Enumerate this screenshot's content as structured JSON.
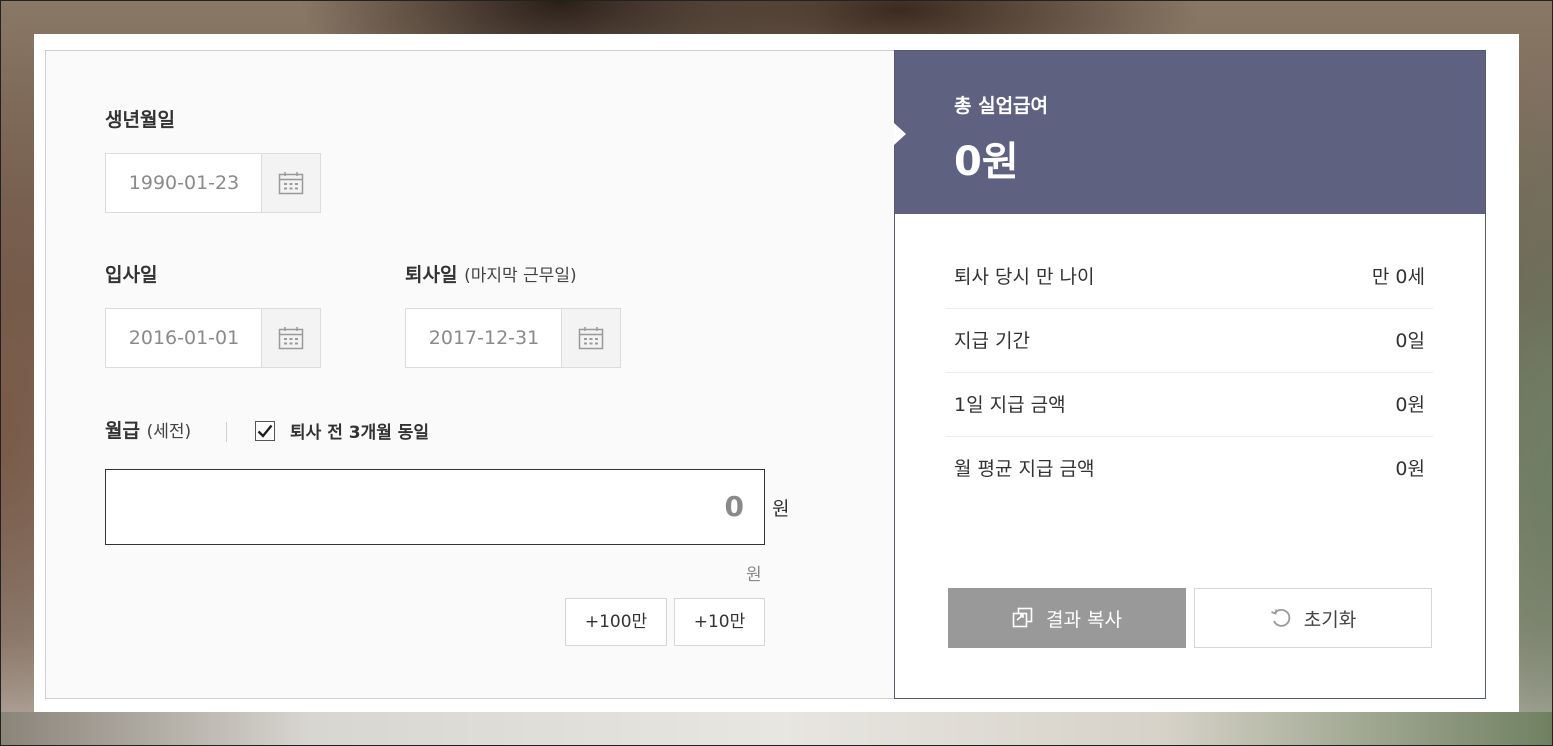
{
  "form": {
    "birth": {
      "label": "생년월일",
      "value": "1990-01-23"
    },
    "join": {
      "label": "입사일",
      "value": "2016-01-01"
    },
    "leave": {
      "label": "퇴사일",
      "label_sub": "(마지막 근무일)",
      "value": "2017-12-31"
    },
    "salary": {
      "label": "월급",
      "label_sub": "(세전)",
      "checkbox_label": "퇴사 전 3개월 동일",
      "checkbox_checked": true,
      "value": "0",
      "unit": "원",
      "unit_hint": "원",
      "add_buttons": [
        "+100만",
        "+10만"
      ]
    }
  },
  "result": {
    "total_label": "총 실업급여",
    "total_value": "0원",
    "rows": [
      {
        "key": "퇴사 당시 만 나이",
        "value": "만 0세"
      },
      {
        "key": "지급 기간",
        "value": "0일"
      },
      {
        "key": "1일 지급 금액",
        "value": "0원"
      },
      {
        "key": "월 평균 지급 금액",
        "value": "0원"
      }
    ],
    "copy_button": "결과 복사",
    "reset_button": "초기화"
  },
  "colors": {
    "accent": "#5f6180",
    "copy_button_bg": "#999999",
    "placeholder_text": "#8a8a8a"
  },
  "icons": {
    "calendar": "calendar-icon",
    "checkbox": "checkmark-icon",
    "copy": "copy-icon",
    "reset": "refresh-icon"
  }
}
